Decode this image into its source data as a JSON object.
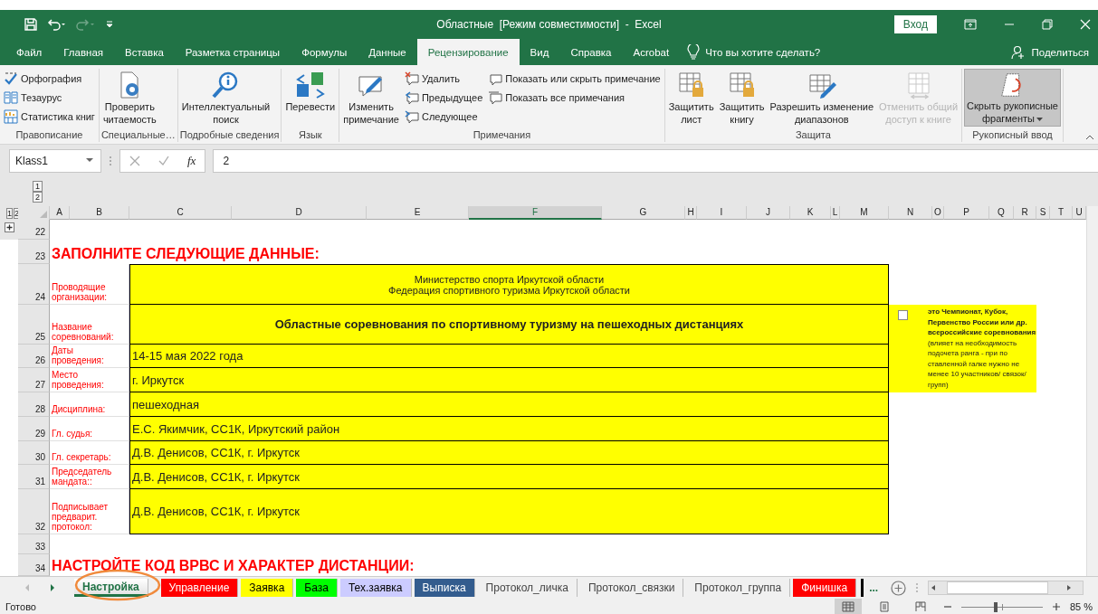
{
  "title_bar": {
    "title": "Областные  [Режим совместимости]  -  Excel",
    "redo_disabled": true,
    "sign_in": "Вход"
  },
  "menu_tabs": [
    {
      "label": "Файл",
      "selected": false
    },
    {
      "label": "Главная",
      "selected": false
    },
    {
      "label": "Вставка",
      "selected": false
    },
    {
      "label": "Разметка страницы",
      "selected": false
    },
    {
      "label": "Формулы",
      "selected": false
    },
    {
      "label": "Данные",
      "selected": false
    },
    {
      "label": "Рецензирование",
      "selected": true
    },
    {
      "label": "Вид",
      "selected": false
    },
    {
      "label": "Справка",
      "selected": false
    },
    {
      "label": "Acrobat",
      "selected": false
    }
  ],
  "tell_me": "Что вы хотите сделать?",
  "share": "Поделиться",
  "ribbon": {
    "groups": [
      {
        "label": "Правописание",
        "columns": [
          {
            "kind": "stack",
            "items": [
              {
                "label": "Орфография"
              },
              {
                "label": "Тезаурус"
              },
              {
                "label": "Статистика книг"
              }
            ]
          }
        ]
      },
      {
        "label": "Специальные…",
        "columns": [
          {
            "kind": "large",
            "label": "Проверить\nчитаемость",
            "disabled": false,
            "selected": false
          }
        ]
      },
      {
        "label": "Подробные сведения",
        "columns": [
          {
            "kind": "large",
            "label": "Интеллектуальный\nпоиск",
            "disabled": false,
            "selected": false
          }
        ]
      },
      {
        "label": "Язык",
        "columns": [
          {
            "kind": "large",
            "label": "Перевести",
            "disabled": false,
            "selected": false
          }
        ]
      },
      {
        "label": "Примечания",
        "columns": [
          {
            "kind": "large",
            "label": "Изменить\nпримечание",
            "disabled": false,
            "selected": false
          },
          {
            "kind": "stack",
            "items": [
              {
                "label": "Удалить"
              },
              {
                "label": "Предыдущее"
              },
              {
                "label": "Следующее"
              }
            ]
          },
          {
            "kind": "stack",
            "items": [
              {
                "label": "Показать или скрыть примечание"
              },
              {
                "label": "Показать все примечания"
              }
            ]
          }
        ]
      },
      {
        "label": "Защита",
        "columns": [
          {
            "kind": "large",
            "label": "Защитить\nлист",
            "disabled": false,
            "selected": false
          },
          {
            "kind": "large",
            "label": "Защитить\nкнигу",
            "disabled": false,
            "selected": false
          },
          {
            "kind": "large",
            "label": "Разрешить изменение\nдиапазонов",
            "disabled": false,
            "selected": false
          },
          {
            "kind": "large",
            "label": "Отменить общий\nдоступ к книге",
            "disabled": true,
            "selected": false
          }
        ]
      },
      {
        "label": "Рукописный ввод",
        "columns": [
          {
            "kind": "large",
            "label": "Скрыть рукописные\nфрагменты",
            "disabled": false,
            "selected": true,
            "dropdown": true
          }
        ]
      }
    ]
  },
  "formula_bar": {
    "name_box": "Klass1",
    "fx": "fx",
    "value": "2"
  },
  "outline": {
    "column_levels": [
      "1",
      "2"
    ],
    "row_levels": [
      "1",
      "2"
    ]
  },
  "sheet": {
    "columns": [
      {
        "label": "A",
        "selected": false
      },
      {
        "label": "B",
        "selected": false
      },
      {
        "label": "C",
        "selected": false
      },
      {
        "label": "D",
        "selected": false
      },
      {
        "label": "E",
        "selected": false
      },
      {
        "label": "F",
        "selected": true
      },
      {
        "label": "G",
        "selected": false
      },
      {
        "label": "H",
        "selected": false
      },
      {
        "label": "I",
        "selected": false
      },
      {
        "label": "J",
        "selected": false
      },
      {
        "label": "K",
        "selected": false
      },
      {
        "label": "L",
        "selected": false
      },
      {
        "label": "M",
        "selected": false
      },
      {
        "label": "N",
        "selected": false
      },
      {
        "label": "O",
        "selected": false
      },
      {
        "label": "P",
        "selected": false
      },
      {
        "label": "Q",
        "selected": false
      },
      {
        "label": "R",
        "selected": false
      },
      {
        "label": "S",
        "selected": false
      },
      {
        "label": "T",
        "selected": false
      },
      {
        "label": "U",
        "selected": false
      }
    ],
    "rows": [
      "22",
      "23",
      "24",
      "25",
      "26",
      "27",
      "28",
      "29",
      "30",
      "31",
      "32",
      "33",
      "34"
    ],
    "heading_1": "ЗАПОЛНИТЕ СЛЕДУЮЩИЕ ДАННЫЕ:",
    "fields": [
      {
        "kind": "centered",
        "label": "Проводящие организации:",
        "value": "Министерство спорта Иркутской области\nФедерация спортивного туризма Иркутской области"
      },
      {
        "kind": "title",
        "label": "Название соревнований:",
        "value": "Областные соревнования по спортивному туризму на пешеходных дистанциях"
      },
      {
        "kind": "plain",
        "label": "Даты проведения:",
        "value": "14-15 мая 2022 года"
      },
      {
        "kind": "plain",
        "label": "Место проведения:",
        "value": "г. Иркутск"
      },
      {
        "kind": "plain",
        "label": "Дисциплина:",
        "value": "пешеходная"
      },
      {
        "kind": "plain",
        "label": "Гл. судья:",
        "value": "Е.С. Якимчик, СС1К, Иркутский район"
      },
      {
        "kind": "plain",
        "label": "Гл. секретарь:",
        "value": "Д.В. Денисов, СС1К, г. Иркутск"
      },
      {
        "kind": "plain",
        "label": "Председатель мандата::",
        "value": "Д.В. Денисов, СС1К, г. Иркутск"
      },
      {
        "kind": "plain",
        "label": "Подписывает предварит. протокол:",
        "value": "Д.В. Денисов, СС1К, г. Иркутск"
      }
    ],
    "note": {
      "checked": false,
      "text": "**это Чемпионат, Кубок, Первенство России или др. всероссийские соревнования** (влияет на необходимость подочета ранга - при по ставленной галке нужно не менее 10 участников/ связок/ групп)"
    },
    "heading_2": "НАСТРОЙТЕ КОД ВРВС И ХАРАКТЕР ДИСТАНЦИИ:"
  },
  "sheet_tabs": [
    {
      "label": "Настройка",
      "selected": true
    },
    {
      "label": "Управление",
      "selected": false,
      "color": "#ff0000"
    },
    {
      "label": "Заявка",
      "selected": false,
      "color": "#ffff00"
    },
    {
      "label": "База",
      "selected": false,
      "color": "#00ff00"
    },
    {
      "label": "Тех.заявка",
      "selected": false,
      "color": "#ccccff"
    },
    {
      "label": "Выписка",
      "selected": false,
      "color": "#335c8e"
    },
    {
      "label": "Протокол_личка",
      "selected": false
    },
    {
      "label": "Протокол_связки",
      "selected": false
    },
    {
      "label": "Протокол_группа",
      "selected": false
    },
    {
      "label": "Финишка",
      "selected": false,
      "color": "#ff0000"
    }
  ],
  "more_tabs": "...",
  "status_bar": {
    "status": "Готово",
    "views": [
      {
        "selected": true
      },
      {
        "selected": false
      },
      {
        "selected": false
      }
    ],
    "zoom": {
      "level": 0.42,
      "reading": "85 %"
    }
  }
}
